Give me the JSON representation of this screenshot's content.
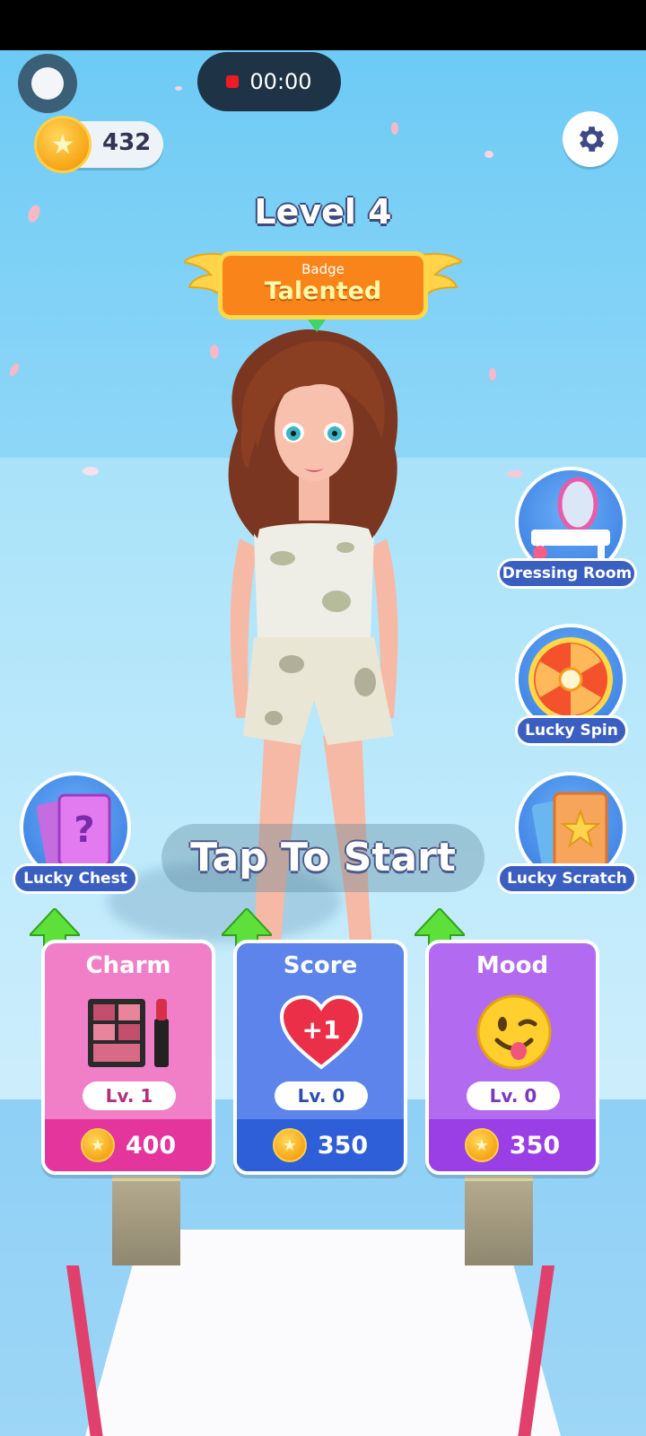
{
  "hud": {
    "record_timer": "00:00",
    "coins": "432",
    "level_label": "Level 4"
  },
  "badge": {
    "caption": "Badge",
    "title": "Talented"
  },
  "side_buttons": {
    "dressing_room": "Dressing Room",
    "lucky_spin": "Lucky Spin",
    "lucky_chest": "Lucky Chest",
    "lucky_scratch": "Lucky Scratch"
  },
  "prompt": "Tap To Start",
  "upgrades": [
    {
      "title": "Charm",
      "level": "Lv. 1",
      "price": "400",
      "icon": "makeup-palette-icon"
    },
    {
      "title": "Score",
      "level": "Lv. 0",
      "price": "350",
      "icon": "heart-plus-one-icon",
      "badge_text": "+1"
    },
    {
      "title": "Mood",
      "level": "Lv. 0",
      "price": "350",
      "icon": "winking-face-icon"
    }
  ],
  "colors": {
    "charm": "#f07fc8",
    "score": "#5c84ea",
    "mood": "#b26af0",
    "badge": "#f98419"
  }
}
